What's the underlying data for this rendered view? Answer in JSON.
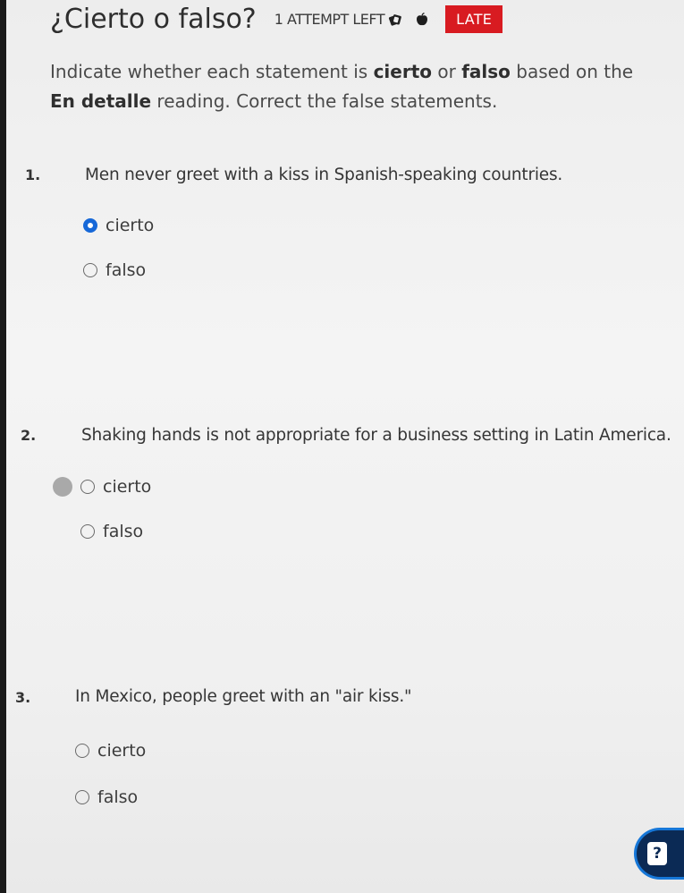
{
  "header": {
    "title": "¿Cierto o falso?",
    "attempts": "1 ATTEMPT LEFT",
    "icons": [
      "cards-icon",
      "apple-icon"
    ],
    "status_badge": "LATE",
    "badge_color": "#d81b21"
  },
  "instructions": {
    "part1": "Indicate whether each statement is ",
    "cierto": "cierto",
    "part2": " or ",
    "falso": "falso",
    "part3": " based on the ",
    "en_detalle": "En detalle",
    "part4": " reading. Correct the false statements."
  },
  "questions": [
    {
      "number": "1.",
      "text": "Men never greet with a kiss in Spanish-speaking countries.",
      "options": [
        {
          "label": "cierto",
          "selected": true
        },
        {
          "label": "falso",
          "selected": false
        }
      ]
    },
    {
      "number": "2.",
      "text": "Shaking hands is not appropriate for a business setting in Latin America.",
      "options": [
        {
          "label": "cierto",
          "selected": false
        },
        {
          "label": "falso",
          "selected": false
        }
      ]
    },
    {
      "number": "3.",
      "text": "In Mexico, people greet with an \"air kiss.\"",
      "options": [
        {
          "label": "cierto",
          "selected": false
        },
        {
          "label": "falso",
          "selected": false
        }
      ]
    }
  ],
  "help": {
    "icon": "help-icon",
    "glyph": "?"
  },
  "colors": {
    "accent": "#1668d8",
    "help_bg": "#0b2a55"
  }
}
